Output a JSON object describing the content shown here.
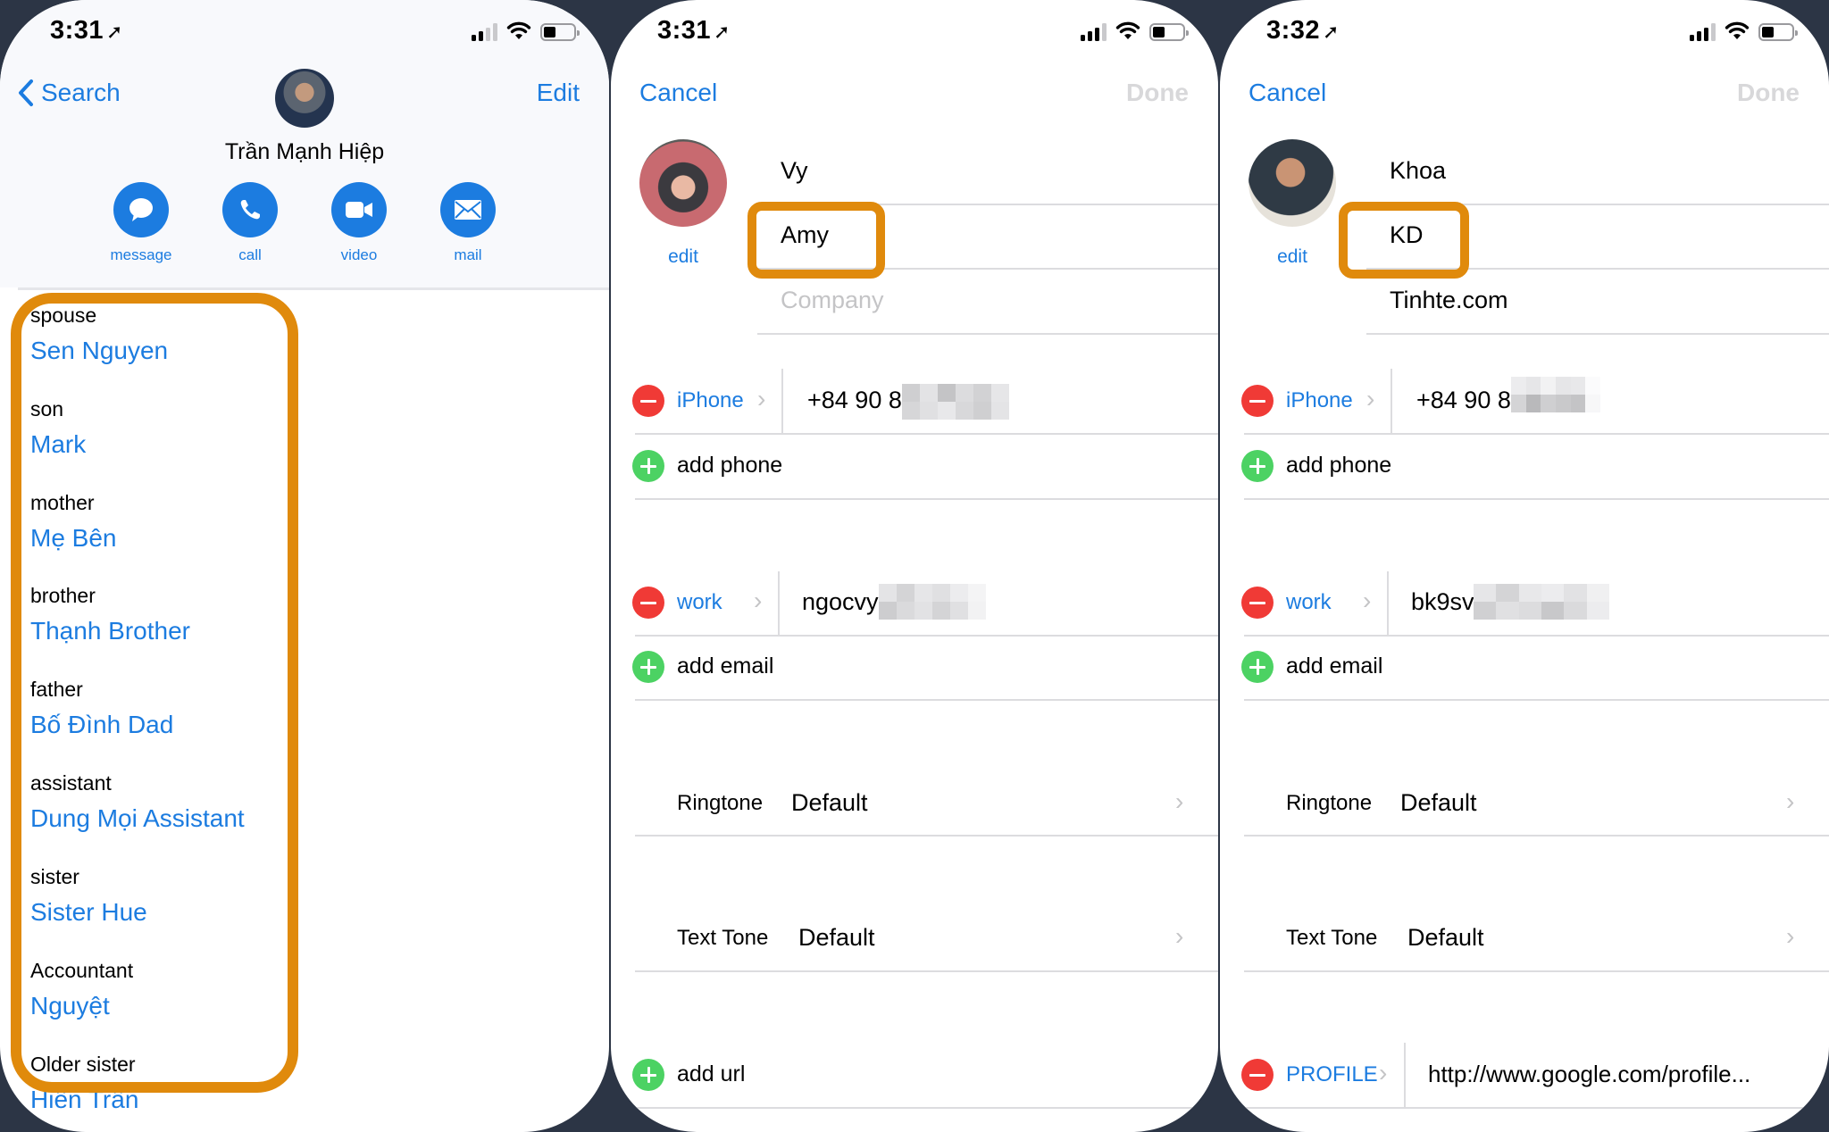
{
  "colors": {
    "accent": "#1c7ce0",
    "highlight": "#e08a0c",
    "delete": "#f03a36",
    "add": "#4cd263",
    "background": "#2c3545"
  },
  "phone1": {
    "status": {
      "time": "3:31",
      "location_icon": "location-arrow-icon",
      "signal_bars_on": 2,
      "signal_bars_total": 4,
      "battery_percent": 30
    },
    "nav": {
      "back_label": "Search",
      "edit_label": "Edit"
    },
    "contact_name": "Trần Mạnh Hiệp",
    "actions": [
      {
        "label": "message",
        "icon": "message-bubble-icon"
      },
      {
        "label": "call",
        "icon": "phone-icon"
      },
      {
        "label": "video",
        "icon": "video-camera-icon"
      },
      {
        "label": "mail",
        "icon": "envelope-icon"
      }
    ],
    "related_names": [
      {
        "label": "spouse",
        "value": "Sen Nguyen"
      },
      {
        "label": "son",
        "value": "Mark"
      },
      {
        "label": "mother",
        "value": "Mẹ Bên"
      },
      {
        "label": "brother",
        "value": "Thạnh Brother"
      },
      {
        "label": "father",
        "value": "Bố Đình Dad"
      },
      {
        "label": "assistant",
        "value": "Dung Mọi Assistant"
      },
      {
        "label": "sister",
        "value": "Sister Hue"
      },
      {
        "label": "Accountant",
        "value": "Nguyệt"
      },
      {
        "label": "Older sister",
        "value": "Hiền Trần"
      }
    ]
  },
  "phone2": {
    "status": {
      "time": "3:31",
      "signal_bars_on": 3,
      "signal_bars_total": 4,
      "battery_percent": 30
    },
    "nav": {
      "cancel_label": "Cancel",
      "done_label": "Done"
    },
    "avatar_edit_label": "edit",
    "first_name": "Vy",
    "nickname": "Amy",
    "company_placeholder": "Company",
    "phone": {
      "label": "iPhone",
      "value": "+84 90 8"
    },
    "add_phone_label": "add phone",
    "email": {
      "label": "work",
      "value": "ngocvy"
    },
    "add_email_label": "add email",
    "ringtone": {
      "label": "Ringtone",
      "value": "Default"
    },
    "text_tone": {
      "label": "Text Tone",
      "value": "Default"
    },
    "add_url_label": "add url"
  },
  "phone3": {
    "status": {
      "time": "3:32",
      "signal_bars_on": 3,
      "signal_bars_total": 4,
      "battery_percent": 30
    },
    "nav": {
      "cancel_label": "Cancel",
      "done_label": "Done"
    },
    "avatar_edit_label": "edit",
    "first_name": "Khoa",
    "nickname": "KD",
    "company": "Tinhte.com",
    "phone": {
      "label": "iPhone",
      "value": "+84 90 8"
    },
    "add_phone_label": "add phone",
    "email": {
      "label": "work",
      "value": "bk9sv"
    },
    "add_email_label": "add email",
    "ringtone": {
      "label": "Ringtone",
      "value": "Default"
    },
    "text_tone": {
      "label": "Text Tone",
      "value": "Default"
    },
    "url": {
      "label": "PROFILE",
      "value": "http://www.google.com/profile..."
    }
  }
}
